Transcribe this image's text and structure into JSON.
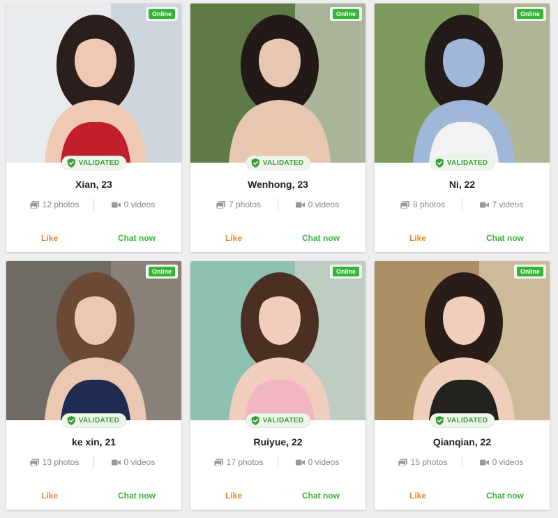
{
  "online_label": "Online",
  "validated_label": "VALIDATED",
  "like_label": "Like",
  "chat_label": "Chat now",
  "colors": {
    "online_green": "#35b536",
    "validated_green": "#3a9a3b",
    "like_orange": "#e5862c",
    "chat_green": "#3db23a"
  },
  "profiles": [
    {
      "name": "Xian, 23",
      "photos": "12 photos",
      "videos": "0 videos",
      "palette": [
        "#e9ecef",
        "#b8c2cc",
        "#c21f2a",
        "#efc9b4",
        "#2a1f1c"
      ]
    },
    {
      "name": "Wenhong, 23",
      "photos": "7 photos",
      "videos": "0 videos",
      "palette": [
        "#5e7a46",
        "#e8e4df",
        "#e8c9ae",
        "#e7c7b2",
        "#221a17"
      ]
    },
    {
      "name": "Ni, 22",
      "photos": "8 photos",
      "videos": "7 videos",
      "palette": [
        "#7d9a5b",
        "#d8cdc4",
        "#f2f2f4",
        "#9fb7d8",
        "#231b19"
      ]
    },
    {
      "name": "ke xin, 21",
      "photos": "13 photos",
      "videos": "0 videos",
      "palette": [
        "#6f6a63",
        "#9d938a",
        "#1e2c52",
        "#ecc8b2",
        "#6b4a35"
      ]
    },
    {
      "name": "Ruiyue, 22",
      "photos": "17 photos",
      "videos": "0 videos",
      "palette": [
        "#8fc1b3",
        "#e8d6cc",
        "#f1b7c1",
        "#f0cdbd",
        "#4b2f23"
      ]
    },
    {
      "name": "Qianqian, 22",
      "photos": "15 photos",
      "videos": "0 videos",
      "palette": [
        "#ab9064",
        "#e8dcc2",
        "#24221f",
        "#efcfbb",
        "#2a1d18"
      ]
    }
  ]
}
